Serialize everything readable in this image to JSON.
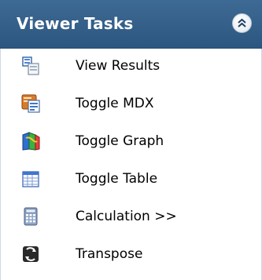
{
  "panel": {
    "title": "Viewer Tasks",
    "collapse_icon": "double-chevron-up-icon"
  },
  "tasks": [
    {
      "label": "View Results",
      "icon": "view-results-icon"
    },
    {
      "label": "Toggle MDX",
      "icon": "toggle-mdx-icon"
    },
    {
      "label": "Toggle Graph",
      "icon": "toggle-graph-icon"
    },
    {
      "label": "Toggle Table",
      "icon": "toggle-table-icon"
    },
    {
      "label": "Calculation >>",
      "icon": "calculator-icon"
    },
    {
      "label": "Transpose",
      "icon": "transpose-icon"
    }
  ],
  "colors": {
    "header_bg": "#2f5a85",
    "header_text": "#ffffff",
    "item_text": "#000000"
  }
}
